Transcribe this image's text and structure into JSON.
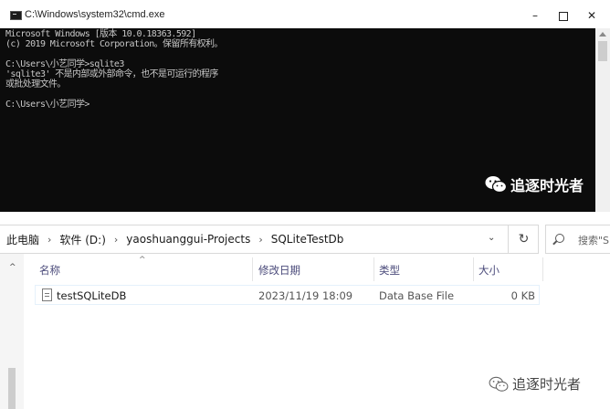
{
  "cmd": {
    "title": "C:\\Windows\\system32\\cmd.exe",
    "controls": {
      "minimize": "–",
      "maximize": "",
      "close": "✕"
    },
    "lines": [
      "Microsoft Windows [版本 10.0.18363.592]",
      "(c) 2019 Microsoft Corporation。保留所有权利。",
      "",
      "C:\\Users\\小艺同学>sqlite3",
      "'sqlite3' 不是内部或外部命令，也不是可运行的程序",
      "或批处理文件。",
      "",
      "C:\\Users\\小艺同学>"
    ],
    "text_color": "#c8c8c8",
    "background": "#0c0c0c"
  },
  "watermark": {
    "text": "追逐时光者",
    "icon": "wechat-icon"
  },
  "explorer": {
    "breadcrumb": [
      "此电脑",
      "软件 (D:)",
      "yaoshuanggui-Projects",
      "SQLiteTestDb"
    ],
    "breadcrumb_separator": "›",
    "dropdown_glyph": "⌄",
    "refresh_glyph": "↻",
    "search_placeholder": "搜索\"S",
    "sort_glyph": "^",
    "nav_scroll_glyph": "^",
    "columns": {
      "name": "名称",
      "date": "修改日期",
      "type": "类型",
      "size": "大小"
    },
    "files": [
      {
        "name": "testSQLiteDB",
        "date": "2023/11/19 18:09",
        "type": "Data Base File",
        "size": "0 KB",
        "icon": "file-icon"
      }
    ]
  }
}
